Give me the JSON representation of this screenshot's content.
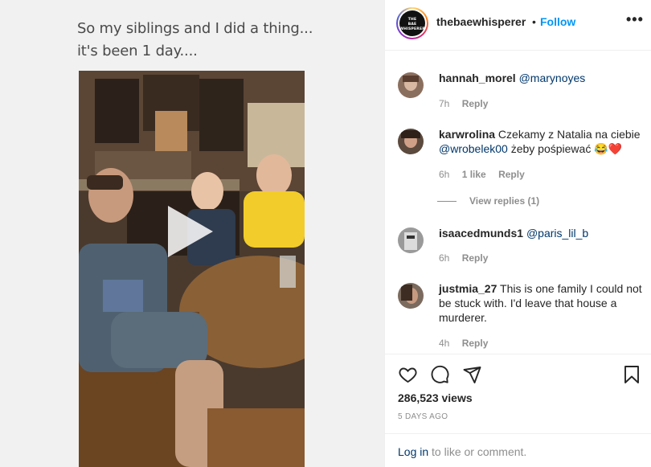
{
  "media": {
    "caption_line1": "So my siblings and I did a thing...",
    "caption_line2": "it's been 1 day...."
  },
  "header": {
    "avatar_logo_line1": "THE",
    "avatar_logo_line2": "BAE",
    "avatar_logo_line3": "WHISPERER",
    "username": "thebaewhisperer",
    "separator": "•",
    "follow_label": "Follow",
    "more_label": "•••"
  },
  "comments": [
    {
      "user": "hannah_morel",
      "text": "",
      "mention": "@marynoyes",
      "time": "7h",
      "likes": "",
      "reply_label": "Reply"
    },
    {
      "user": "karwrolina",
      "text": "Czekamy z Natalia na ciebie",
      "mention": "@wrobelek00",
      "text_after": "żeby pośpiewać 😂❤️",
      "time": "6h",
      "likes": "1 like",
      "reply_label": "Reply",
      "view_replies": "View replies (1)"
    },
    {
      "user": "isaacedmunds1",
      "text": "",
      "mention": "@paris_lil_b",
      "time": "6h",
      "likes": "",
      "reply_label": "Reply"
    },
    {
      "user": "justmia_27",
      "text": "This is one family I could not be stuck with. I'd leave that house a murderer.",
      "mention": "",
      "time": "4h",
      "likes": "",
      "reply_label": "Reply"
    }
  ],
  "actions": {
    "views": "286,523 views",
    "date": "5 DAYS AGO",
    "login_link": "Log in",
    "login_rest": "to like or comment."
  },
  "colors": {
    "accent": "#0095f6",
    "mention": "#00376b",
    "muted": "#8e8e8e"
  },
  "icons": [
    "heart-icon",
    "comment-icon",
    "share-icon",
    "bookmark-icon",
    "play-icon"
  ]
}
